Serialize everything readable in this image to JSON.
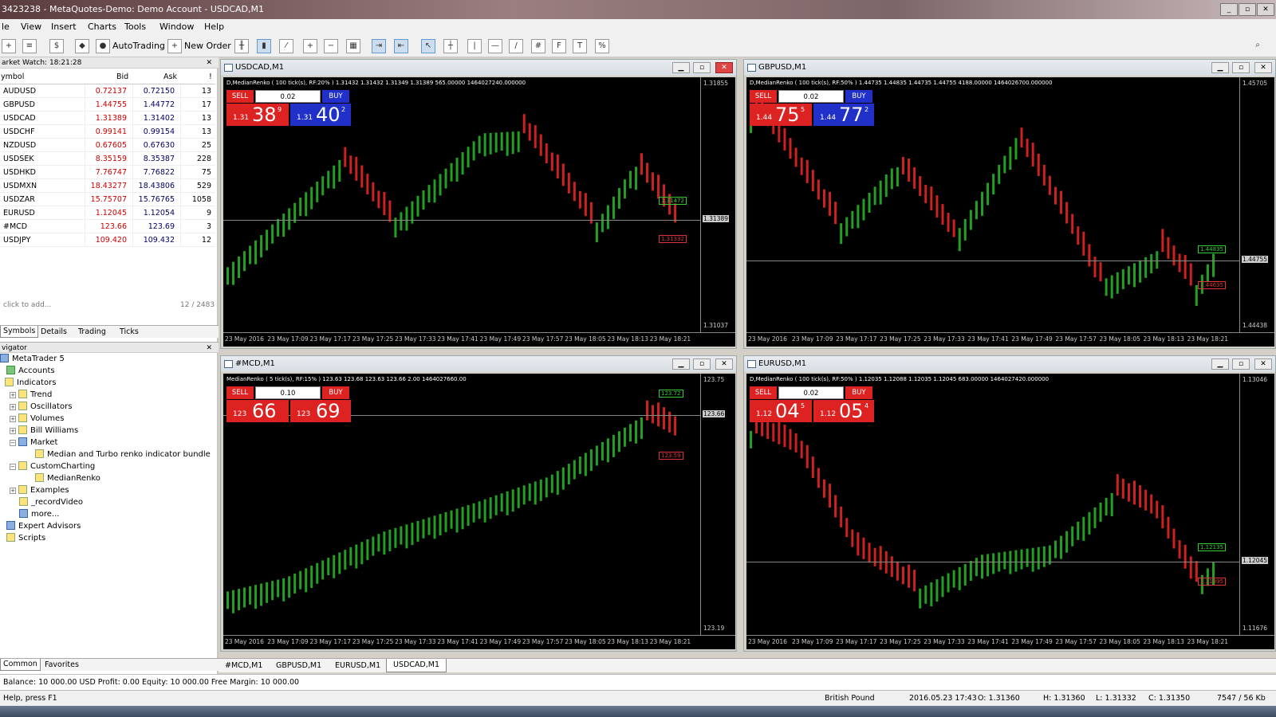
{
  "window": {
    "title": "3423238 - MetaQuotes-Demo: Demo Account - USDCAD,M1"
  },
  "menu": [
    "le",
    "View",
    "Insert",
    "Charts",
    "Tools",
    "Window",
    "Help"
  ],
  "toolbar": {
    "autotrading": "AutoTrading",
    "new_order": "New Order"
  },
  "market_watch": {
    "title": "arket Watch: 18:21:28",
    "columns": {
      "symbol": "ymbol",
      "bid": "Bid",
      "ask": "Ask",
      "spread": "!"
    },
    "rows": [
      {
        "symbol": "AUDUSD",
        "bid": "0.72137",
        "ask": "0.72150",
        "spread": "13"
      },
      {
        "symbol": "GBPUSD",
        "bid": "1.44755",
        "ask": "1.44772",
        "spread": "17"
      },
      {
        "symbol": "USDCAD",
        "bid": "1.31389",
        "ask": "1.31402",
        "spread": "13"
      },
      {
        "symbol": "USDCHF",
        "bid": "0.99141",
        "ask": "0.99154",
        "spread": "13"
      },
      {
        "symbol": "NZDUSD",
        "bid": "0.67605",
        "ask": "0.67630",
        "spread": "25"
      },
      {
        "symbol": "USDSEK",
        "bid": "8.35159",
        "ask": "8.35387",
        "spread": "228"
      },
      {
        "symbol": "USDHKD",
        "bid": "7.76747",
        "ask": "7.76822",
        "spread": "75"
      },
      {
        "symbol": "USDMXN",
        "bid": "18.43277",
        "ask": "18.43806",
        "spread": "529"
      },
      {
        "symbol": "USDZAR",
        "bid": "15.75707",
        "ask": "15.76765",
        "spread": "1058"
      },
      {
        "symbol": "EURUSD",
        "bid": "1.12045",
        "ask": "1.12054",
        "spread": "9"
      },
      {
        "symbol": "#MCD",
        "bid": "123.66",
        "ask": "123.69",
        "spread": "3"
      },
      {
        "symbol": "USDJPY",
        "bid": "109.420",
        "ask": "109.432",
        "spread": "12"
      }
    ],
    "add_hint": "click to add...",
    "count": "12 / 2483",
    "tabs": [
      "Symbols",
      "Details",
      "Trading",
      "Ticks"
    ]
  },
  "navigator": {
    "title": "vigator",
    "items": [
      "MetaTrader 5",
      "Accounts",
      "Indicators",
      "Trend",
      "Oscillators",
      "Volumes",
      "Bill Williams",
      "Market",
      "Median and Turbo renko indicator bundle",
      "CustomCharting",
      "MedianRenko",
      "Examples",
      "_recordVideo",
      "more...",
      "Expert Advisors",
      "Scripts"
    ],
    "tabs": [
      "Common",
      "Favorites"
    ]
  },
  "time_axis": [
    "23 May 2016",
    "23 May 17:09",
    "23 May 17:17",
    "23 May 17:25",
    "23 May 17:33",
    "23 May 17:41",
    "23 May 17:49",
    "23 May 17:57",
    "23 May 18:05",
    "23 May 18:13",
    "23 May 18:21"
  ],
  "charts": [
    {
      "title": "USDCAD,M1",
      "info": "D,MedianRenko ( 100 tick(s), RF:20% ) 1.31432 1.31432 1.31349 1.31389 565.00000 1464027240.000000",
      "lot": "0.02",
      "sell": "SELL",
      "buy": "BUY",
      "bid_pre": "1.31",
      "bid_big": "38",
      "bid_sup": "9",
      "ask_pre": "1.31",
      "ask_big": "40",
      "ask_sup": "2",
      "axis_top": "1.31855",
      "axis_bottom": "1.31037",
      "price_line": "1.31389",
      "label_green": "1.31472",
      "label_red": "1.31332",
      "buy_color": "#2030c8"
    },
    {
      "title": "GBPUSD,M1",
      "info": "D,MedianRenko ( 100 tick(s), RF:50% ) 1.44735 1.44835 1.44735 1.44755 4188.00000 1464026700.000000",
      "lot": "0.02",
      "sell": "SELL",
      "buy": "BUY",
      "bid_pre": "1.44",
      "bid_big": "75",
      "bid_sup": "5",
      "ask_pre": "1.44",
      "ask_big": "77",
      "ask_sup": "2",
      "axis_top": "1.45705",
      "axis_bottom": "1.44438",
      "price_line": "1.44755",
      "label_green": "1.44835",
      "label_red": "1.44635",
      "buy_color": "#2030c8"
    },
    {
      "title": "#MCD,M1",
      "info": "MedianRenko ( 5 tick(s), RF:15% ) 123.63 123.68 123.63 123.66 2.00 1464027660.00",
      "lot": "0.10",
      "sell": "SELL",
      "buy": "BUY",
      "bid_pre": "123",
      "bid_big": "66",
      "bid_sup": "",
      "ask_pre": "123",
      "ask_big": "69",
      "ask_sup": "",
      "axis_top": "123.75",
      "axis_bottom": "123.19",
      "price_line": "123.66",
      "label_green": "123.72",
      "label_red": "123.59",
      "buy_color": "#d22"
    },
    {
      "title": "EURUSD,M1",
      "info": "D,MedianRenko ( 100 tick(s), RF:50% ) 1.12035 1.12088 1.12035 1.12045 683.00000 1464027420.000000",
      "lot": "0.02",
      "sell": "SELL",
      "buy": "BUY",
      "bid_pre": "1.12",
      "bid_big": "04",
      "bid_sup": "5",
      "ask_pre": "1.12",
      "ask_big": "05",
      "ask_sup": "4",
      "axis_top": "1.13046",
      "axis_bottom": "1.11676",
      "price_line": "1.12045",
      "label_green": "1.12135",
      "label_red": "1.11995",
      "buy_color": "#d22"
    }
  ],
  "chart_tabs": [
    "#MCD,M1",
    "GBPUSD,M1",
    "EURUSD,M1",
    "USDCAD,M1"
  ],
  "balance": "Balance: 10 000.00 USD  Profit: 0.00  Equity: 10 000.00  Free Margin: 10 000.00",
  "status": {
    "help": "Help, press F1",
    "symbol": "British Pound",
    "datetime": "2016.05.23 17:43",
    "open": "O: 1.31360",
    "high": "H: 1.31360",
    "low": "L: 1.31332",
    "close": "C: 1.31350",
    "traffic": "7547 / 56 Kb"
  }
}
